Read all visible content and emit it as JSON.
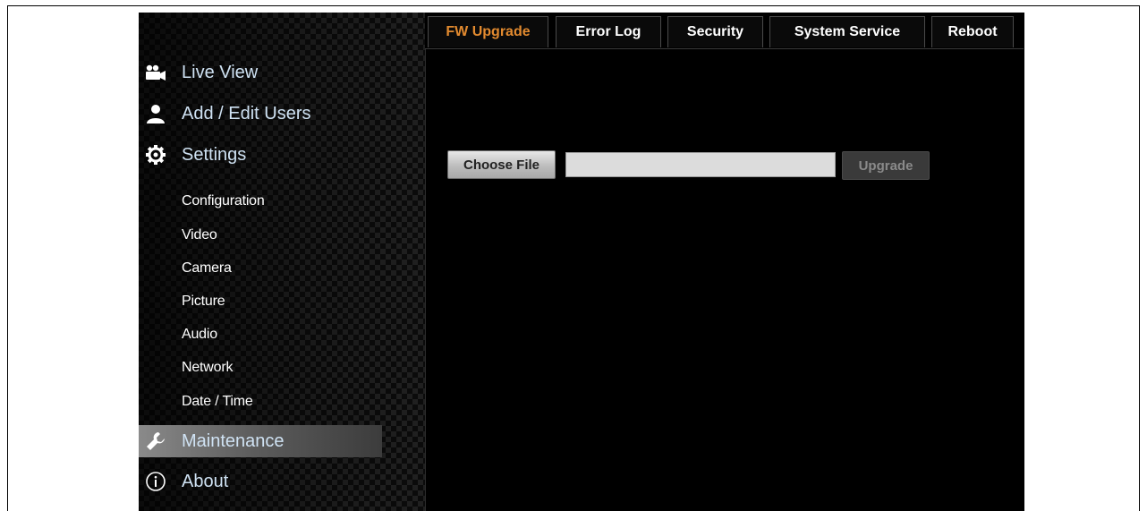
{
  "nav": {
    "items": [
      {
        "label": "Live View",
        "icon": "video-camera-icon"
      },
      {
        "label": "Add / Edit Users",
        "icon": "user-icon"
      },
      {
        "label": "Settings",
        "icon": "gear-icon"
      },
      {
        "label": "Maintenance",
        "icon": "wrench-icon",
        "active": true
      },
      {
        "label": "About",
        "icon": "info-icon"
      }
    ],
    "sub_items": [
      "Configuration",
      "Video",
      "Camera",
      "Picture",
      "Audio",
      "Network",
      "Date / Time"
    ]
  },
  "tabs": [
    {
      "label": "FW Upgrade",
      "active": true
    },
    {
      "label": "Error Log"
    },
    {
      "label": "Security"
    },
    {
      "label": "System Service"
    },
    {
      "label": "Reboot"
    }
  ],
  "fw_upgrade": {
    "choose_file_label": "Choose File",
    "file_value": "",
    "upgrade_label": "Upgrade"
  },
  "colors": {
    "active_tab_text": "#e28a2f",
    "nav_text": "#cfe2f3",
    "background": "#000000"
  }
}
